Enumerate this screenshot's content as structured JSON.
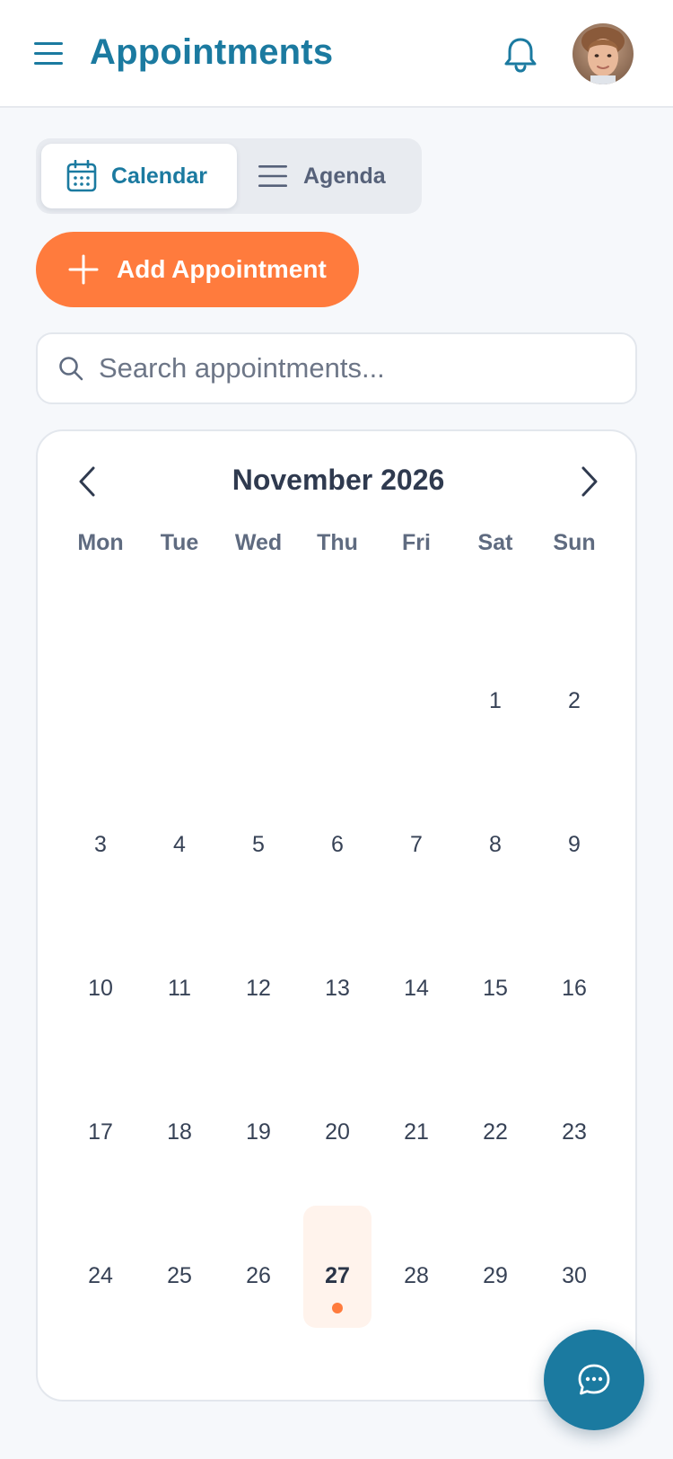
{
  "header": {
    "title": "Appointments",
    "menu_icon": "hamburger-menu-icon",
    "notification_icon": "bell-icon",
    "avatar": "user-avatar"
  },
  "view_toggle": {
    "calendar_label": "Calendar",
    "agenda_label": "Agenda",
    "active": "Calendar"
  },
  "actions": {
    "add_label": "Add Appointment"
  },
  "search": {
    "placeholder": "Search appointments..."
  },
  "calendar": {
    "month_label": "November 2026",
    "weekdays": [
      "Mon",
      "Tue",
      "Wed",
      "Thu",
      "Fri",
      "Sat",
      "Sun"
    ],
    "leading_blank_days": 5,
    "days": [
      "1",
      "2",
      "3",
      "4",
      "5",
      "6",
      "7",
      "8",
      "9",
      "10",
      "11",
      "12",
      "13",
      "14",
      "15",
      "16",
      "17",
      "18",
      "19",
      "20",
      "21",
      "22",
      "23",
      "24",
      "25",
      "26",
      "27",
      "28",
      "29",
      "30"
    ],
    "selected_day": "27",
    "days_with_events": [
      "27"
    ]
  },
  "colors": {
    "primary": "#1b7aa0",
    "accent": "#ff7b3d",
    "today_highlight": "#fff3ec"
  },
  "fab": {
    "icon": "chat-bubble-icon"
  }
}
